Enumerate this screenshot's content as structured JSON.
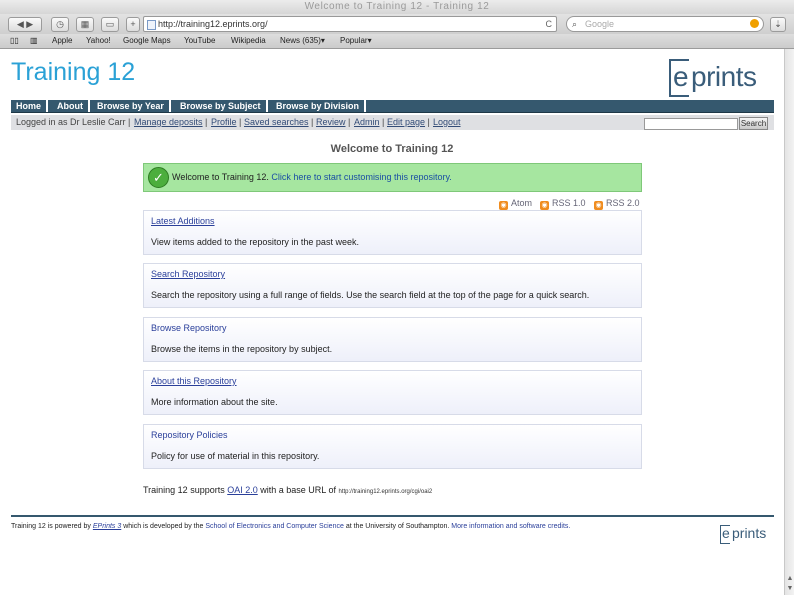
{
  "browser": {
    "window_title": "Welcome to Training 12 - Training 12",
    "url": "http://training12.eprints.org/",
    "search_placeholder": "Google",
    "reload_icon": "C",
    "bookmarks": [
      "Apple",
      "Yahoo!",
      "Google Maps",
      "YouTube",
      "Wikipedia",
      "News (635)▾",
      "Popular▾"
    ]
  },
  "site": {
    "title": "Training 12",
    "logo_e": "e",
    "logo_rest": "prints",
    "menu": [
      "Home",
      "About",
      "Browse by Year",
      "Browse by Subject",
      "Browse by Division"
    ],
    "login": {
      "prefix": "Logged in as Dr Leslie Carr |",
      "links": [
        "Manage deposits",
        "Profile",
        "Saved searches",
        "Review",
        "Admin",
        "Edit page",
        "Logout"
      ],
      "search_button": "Search"
    }
  },
  "main": {
    "heading": "Welcome to Training 12",
    "notice_prefix": "Welcome to Training 12.",
    "notice_link": "Click here to start customising this repository.",
    "feeds": [
      "Atom",
      "RSS 1.0",
      "RSS 2.0"
    ],
    "boxes": [
      {
        "title": "Latest Additions",
        "desc": "View items added to the repository in the past week."
      },
      {
        "title": "Search Repository",
        "desc": "Search the repository using a full range of fields. Use the search field at the top of the page for a quick search."
      },
      {
        "title": "Browse Repository",
        "desc": "Browse the items in the repository by subject."
      },
      {
        "title": "About this Repository",
        "desc": "More information about the site."
      },
      {
        "title": "Repository Policies",
        "desc": "Policy for use of material in this repository."
      }
    ],
    "oai_prefix": "Training 12 supports",
    "oai_link": "OAI 2.0",
    "oai_middle": "with a base URL of",
    "oai_url": "http://training12.eprints.org/cgi/oai2"
  },
  "footer": {
    "p1": "Training 12 is powered by",
    "eprints_link": "EPrints 3",
    "p2": "which is developed by the",
    "school_link": "School of Electronics and Computer Science",
    "p3": "at the University of Southampton.",
    "credits_link": "More information and software credits.",
    "logo_e": "e",
    "logo_rest": "prints"
  },
  "colors": {
    "title_blue": "#2aa1d6",
    "menu_bg": "#35586e",
    "notice_bg": "#a6e6a0",
    "link_blue": "#2a3f9a"
  }
}
